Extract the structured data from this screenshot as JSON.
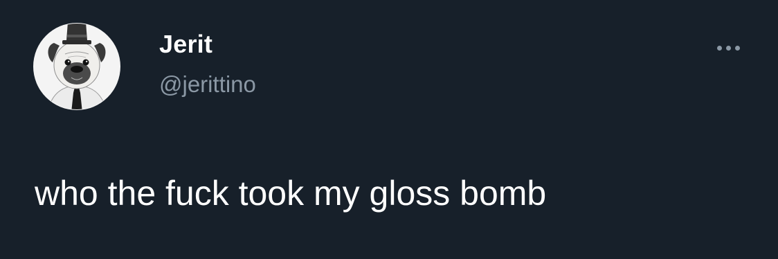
{
  "tweet": {
    "author": {
      "display_name": "Jerit",
      "handle": "@jerittino",
      "avatar_icon": "pug-in-top-hat-avatar"
    },
    "more_icon": "more-options-icon",
    "text": "who the fuck took my gloss bomb"
  },
  "colors": {
    "background": "#17202a",
    "primary_text": "#ffffff",
    "secondary_text": "#8b98a5"
  }
}
